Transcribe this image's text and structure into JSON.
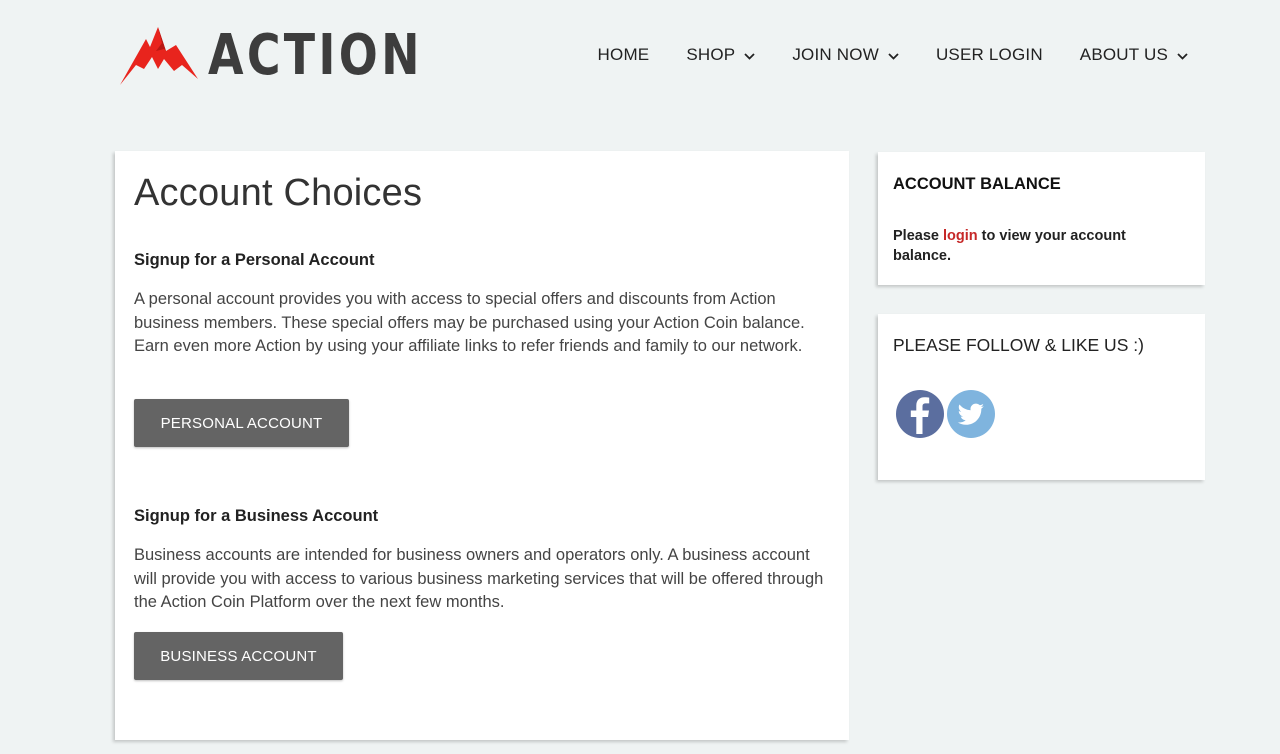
{
  "logo": {
    "text": "ACTION",
    "accent_color": "#e8241d"
  },
  "nav": {
    "items": [
      {
        "label": "HOME",
        "has_dropdown": false
      },
      {
        "label": "SHOP",
        "has_dropdown": true
      },
      {
        "label": "JOIN NOW",
        "has_dropdown": true
      },
      {
        "label": "USER LOGIN",
        "has_dropdown": false
      },
      {
        "label": "ABOUT US",
        "has_dropdown": true
      }
    ]
  },
  "main": {
    "title": "Account Choices",
    "personal": {
      "heading": "Signup for a Personal Account",
      "body": "A personal account provides you with access to special offers and discounts from Action business members.  These special offers may be purchased using your Action Coin balance.  Earn even more Action by using your affiliate links to refer friends and family to our network.",
      "button_label": "PERSONAL ACCOUNT"
    },
    "business": {
      "heading": "Signup for a Business Account",
      "body": "Business accounts are intended for business owners and operators only.  A business account will provide you with access to various business marketing services that will be offered through the Action Coin Platform over the next few months.",
      "button_label": "BUSINESS ACCOUNT"
    }
  },
  "sidebar": {
    "balance": {
      "title": "ACCOUNT BALANCE",
      "text_before": "Please ",
      "login_link": "login",
      "text_after": " to view your account balance.",
      "link_color": "#c62828"
    },
    "follow": {
      "title": "PLEASE FOLLOW & LIKE US :)",
      "icons": [
        "facebook-icon",
        "twitter-icon"
      ]
    }
  },
  "colors": {
    "page_bg": "#eff3f3",
    "button_bg": "#646464",
    "facebook": "#5b6e9f",
    "twitter": "#7fb4de"
  }
}
